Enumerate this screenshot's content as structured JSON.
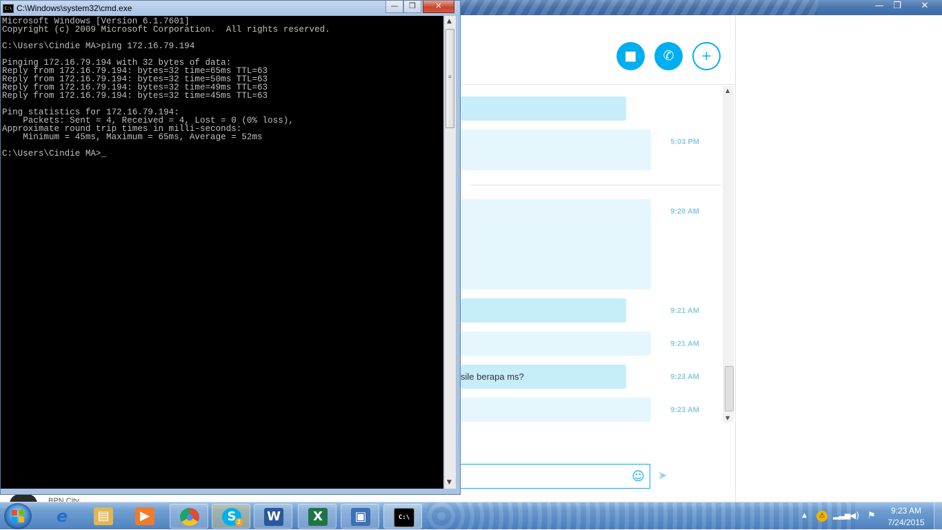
{
  "cmd": {
    "title": "C:\\Windows\\system32\\cmd.exe",
    "icon_text": "C:\\",
    "buttons": {
      "minimize": "—",
      "maximize": "❐",
      "close": "✕"
    },
    "console_text": "Microsoft Windows [Version 6.1.7601]\nCopyright (c) 2009 Microsoft Corporation.  All rights reserved.\n\nC:\\Users\\Cindie MA>ping 172.16.79.194\n\nPinging 172.16.79.194 with 32 bytes of data:\nReply from 172.16.79.194: bytes=32 time=65ms TTL=63\nReply from 172.16.79.194: bytes=32 time=50ms TTL=63\nReply from 172.16.79.194: bytes=32 time=49ms TTL=63\nReply from 172.16.79.194: bytes=32 time=45ms TTL=63\n\nPing statistics for 172.16.79.194:\n    Packets: Sent = 4, Received = 4, Lost = 0 (0% loss),\nApproximate round trip times in milli-seconds:\n    Minimum = 45ms, Maximum = 65ms, Average = 52ms\n\nC:\\Users\\Cindie MA>_"
  },
  "skype": {
    "window_buttons": {
      "minimize": "—",
      "maximize": "❐",
      "close": "✕"
    },
    "actions": {
      "video_icon": "■",
      "call_icon": "✆",
      "add_icon": "+"
    },
    "messages": [
      {
        "text": "",
        "time": "5:03 PM"
      },
      {
        "text": "",
        "time": "9:20 AM"
      },
      {
        "text": "",
        "time": "9:21 AM"
      },
      {
        "text": "",
        "time": "9:21 AM"
      },
      {
        "text": "sile berapa ms?",
        "time": "9:23 AM"
      },
      {
        "text": "",
        "time": "9:23 AM"
      }
    ],
    "emoji_icon": "☺",
    "send_icon": "➤",
    "contact_name": "BPN City"
  },
  "taskbar": {
    "items": [
      {
        "name": "internet-explorer",
        "glyph": "e",
        "color": "#1f6fd1"
      },
      {
        "name": "windows-explorer",
        "glyph": "▤",
        "color": "#e2b652"
      },
      {
        "name": "media-player",
        "glyph": "▶",
        "color": "#f07c2b"
      },
      {
        "name": "chrome",
        "glyph": "●",
        "color": "#dd4b39"
      },
      {
        "name": "skype",
        "glyph": "S",
        "color": "#00aff0",
        "badge": "2"
      },
      {
        "name": "word",
        "glyph": "W",
        "color": "#2b579a"
      },
      {
        "name": "excel",
        "glyph": "X",
        "color": "#217346"
      },
      {
        "name": "remote-desktop",
        "glyph": "▣",
        "color": "#3c6fb4"
      },
      {
        "name": "cmd",
        "glyph": "C:\\",
        "color": "#000000"
      }
    ],
    "tray": {
      "show_hidden": "▲",
      "network": "▂▃▅",
      "volume": "◀)",
      "action_center": "⚑"
    },
    "clock": {
      "time": "9:23 AM",
      "date": "7/24/2015"
    }
  }
}
